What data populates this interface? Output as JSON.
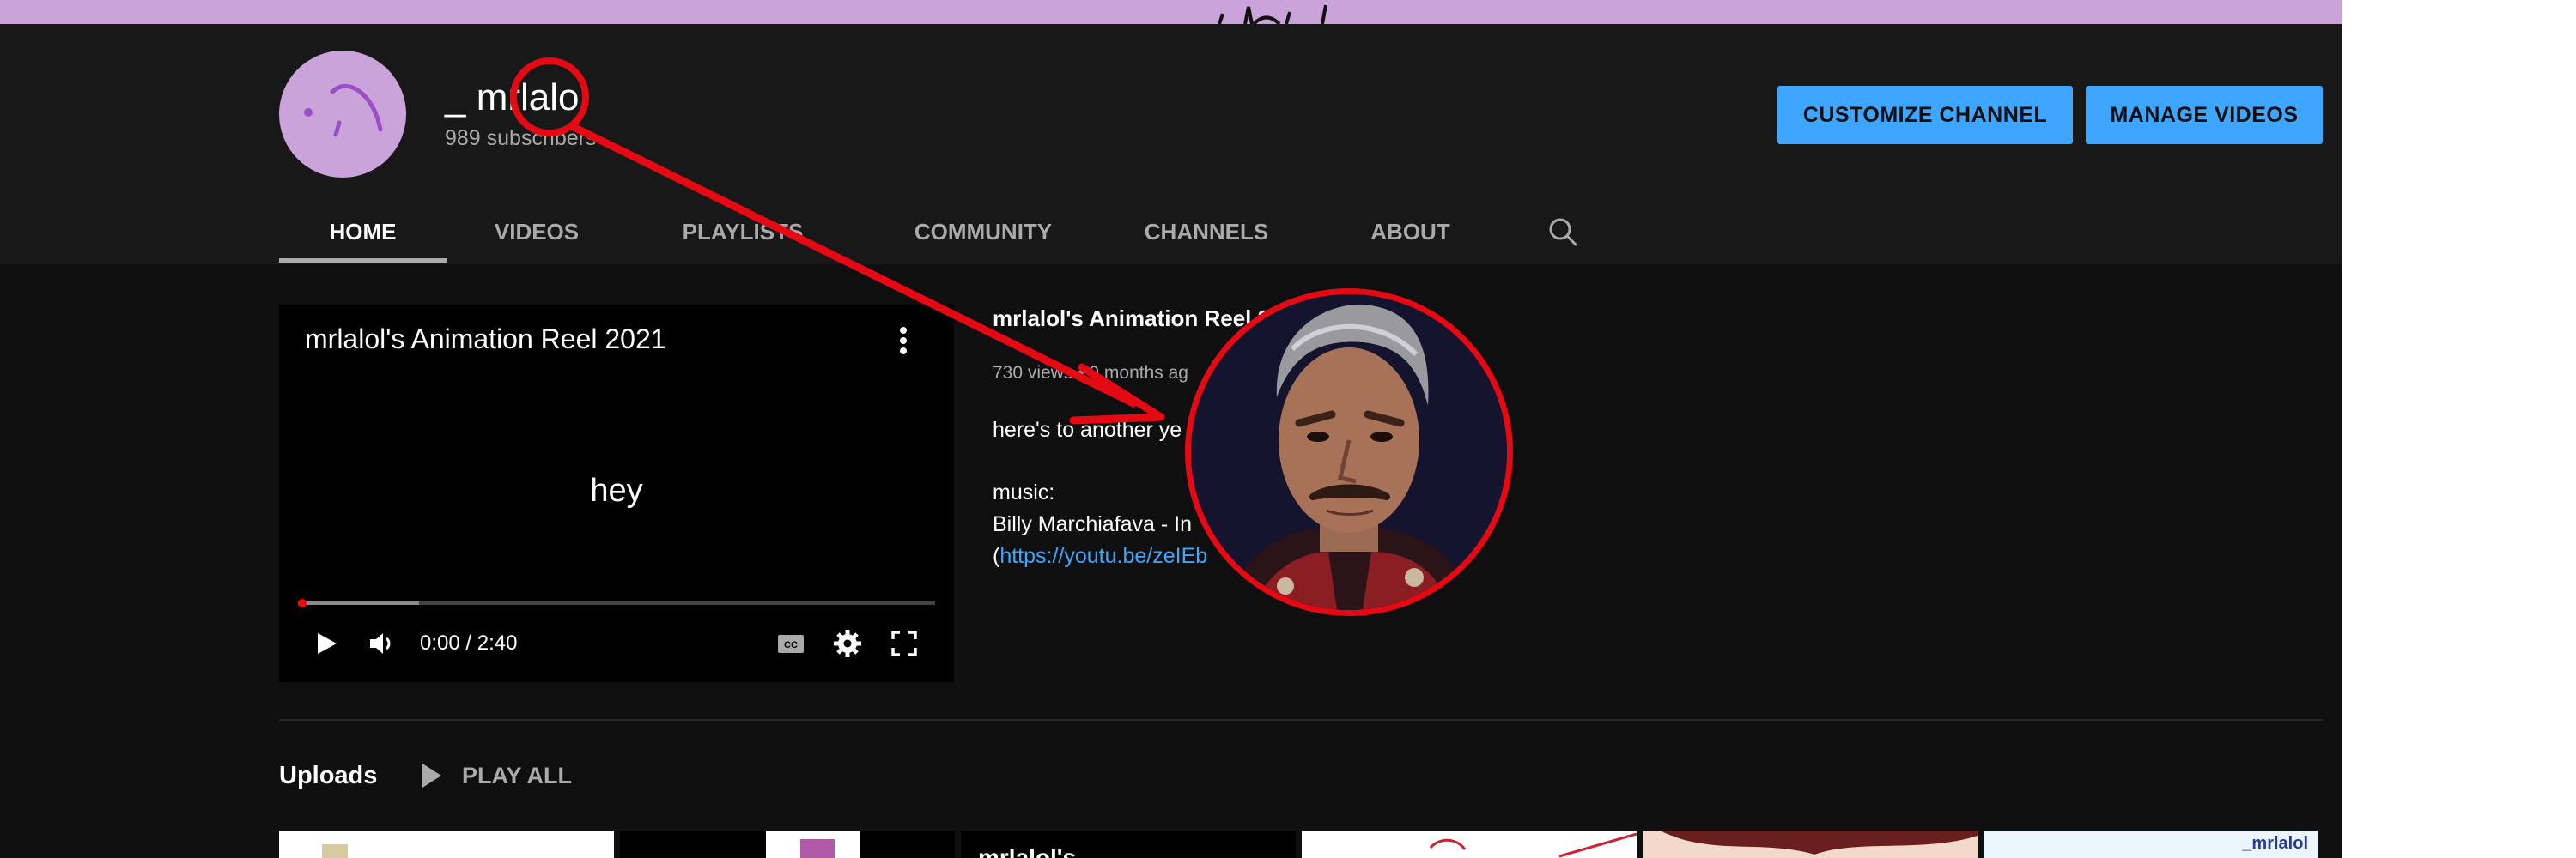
{
  "banner": {
    "color": "#c9a3d9"
  },
  "channel": {
    "avatar_icon": "purple-face-doodle",
    "name": "_ mrlalo",
    "subscribers": "989 subscribers",
    "customize_label": "CUSTOMIZE CHANNEL",
    "manage_label": "MANAGE VIDEOS"
  },
  "tabs": [
    {
      "label": "HOME",
      "active": true
    },
    {
      "label": "VIDEOS"
    },
    {
      "label": "PLAYLISTS"
    },
    {
      "label": "COMMUNITY"
    },
    {
      "label": "CHANNELS"
    },
    {
      "label": "ABOUT"
    }
  ],
  "featured": {
    "title": "mrlalol's Animation Reel 2021",
    "center_text": "hey",
    "time": "0:00 / 2:40",
    "progress": 0.0,
    "buffered": 0.19,
    "meta_title": "mrlalol's Animation Reel 20",
    "meta_stats": "730 views • 9 months ag",
    "desc_line1": "here's to another ye",
    "desc_music": "music:",
    "desc_artist": "Billy Marchiafava - In",
    "desc_link_open": "(",
    "desc_link": "https://youtu.be/zeIEb"
  },
  "uploads": {
    "label": "Uploads",
    "play_all": "PLAY ALL",
    "thumbs": [
      {
        "text": "",
        "bg": "#ffffff"
      },
      {
        "text": "",
        "bg": "#000000"
      },
      {
        "text": "mrlalol's",
        "bg": "#000000"
      },
      {
        "text": "",
        "bg": "#ffffff"
      },
      {
        "text": "",
        "bg": "#f3d9cc"
      },
      {
        "text": "_mrlalol",
        "bg": "#eaf6fb"
      }
    ]
  },
  "annotation": {
    "color": "#e50914",
    "portrait": "man-with-mustache-portrait"
  }
}
